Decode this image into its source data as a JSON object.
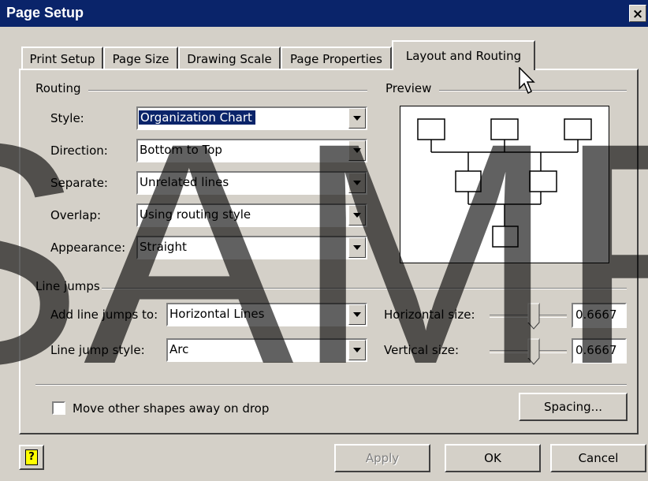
{
  "window": {
    "title": "Page Setup",
    "close_glyph": "×"
  },
  "tabs": [
    {
      "label": "Print Setup"
    },
    {
      "label": "Page Size"
    },
    {
      "label": "Drawing Scale"
    },
    {
      "label": "Page Properties"
    },
    {
      "label": "Layout and Routing",
      "active": true
    }
  ],
  "routing": {
    "group_label": "Routing",
    "style": {
      "label": "Style:",
      "value": "Organization Chart"
    },
    "direction": {
      "label": "Direction:",
      "value": "Bottom to Top"
    },
    "separate": {
      "label": "Separate:",
      "value": "Unrelated lines"
    },
    "overlap": {
      "label": "Overlap:",
      "value": "Using routing style"
    },
    "appearance": {
      "label": "Appearance:",
      "value": "Straight"
    }
  },
  "preview": {
    "group_label": "Preview"
  },
  "line_jumps": {
    "group_label": "Line jumps",
    "add_to": {
      "label": "Add line jumps to:",
      "value": "Horizontal Lines"
    },
    "style": {
      "label": "Line jump style:",
      "value": "Arc"
    },
    "horizontal_size": {
      "label": "Horizontal size:",
      "value": "0.6667"
    },
    "vertical_size": {
      "label": "Vertical size:",
      "value": "0.6667"
    }
  },
  "move_shapes": {
    "label": "Move other shapes away on drop",
    "checked": false
  },
  "buttons": {
    "spacing": "Spacing...",
    "apply": "Apply",
    "ok": "OK",
    "cancel": "Cancel",
    "help_glyph": "?"
  },
  "watermark": {
    "text": "SAMP"
  },
  "colors": {
    "title_bar": "#0a246a",
    "dialog_face": "#d4d0c8",
    "selection": "#0a246a"
  },
  "icons": {
    "help": "help-icon",
    "cursor": "mouse-pointer-icon",
    "dropdown": "chevron-down-icon"
  }
}
